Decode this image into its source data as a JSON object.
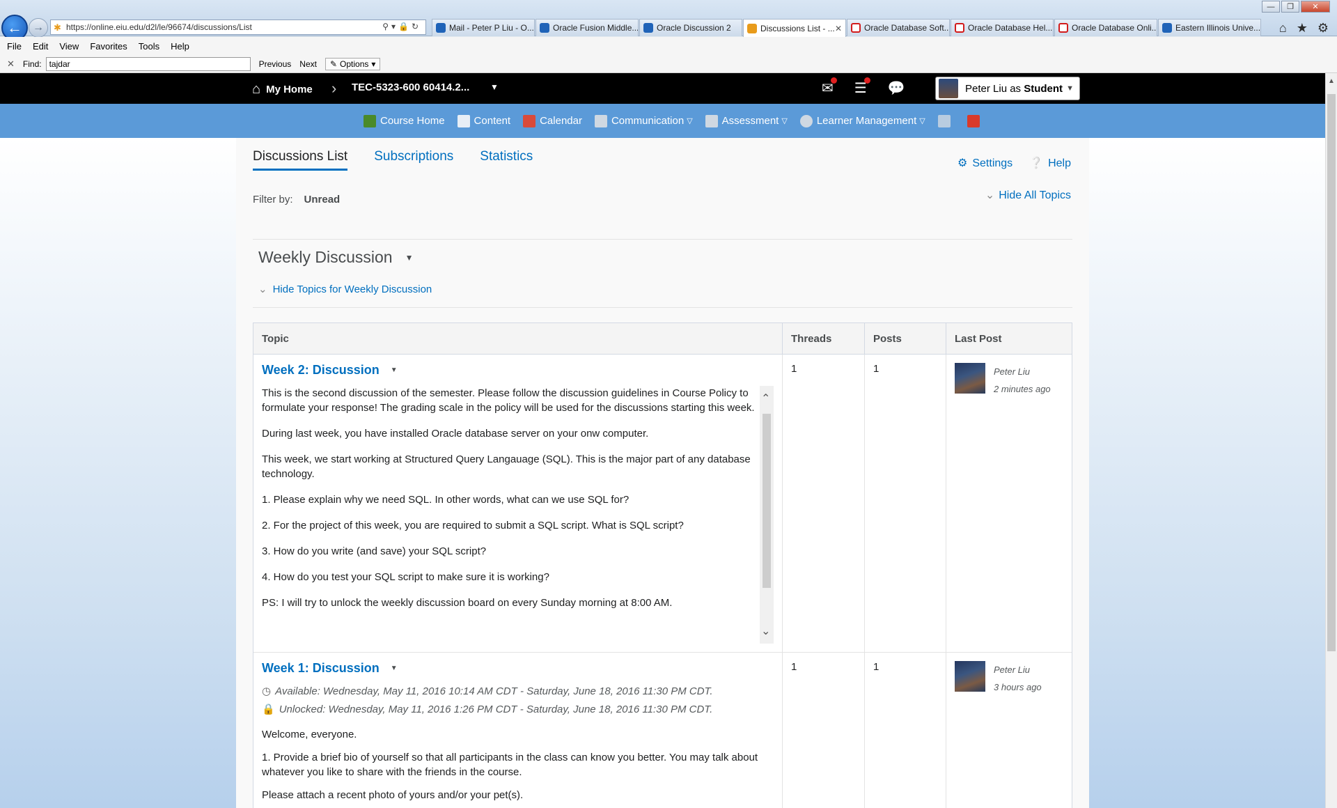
{
  "browser": {
    "url": "https://online.eiu.edu/d2l/le/96674/discussions/List",
    "tabs": [
      {
        "label": "Mail - Peter P Liu - O...",
        "icon": "outlook-icon"
      },
      {
        "label": "Oracle Fusion Middle...",
        "icon": "page-icon"
      },
      {
        "label": "Oracle Discussion 2",
        "icon": "page-icon"
      },
      {
        "label": "Discussions List - ...",
        "icon": "d2l-icon",
        "active": true
      },
      {
        "label": "Oracle Database Soft...",
        "icon": "oracle-icon"
      },
      {
        "label": "Oracle Database Hel...",
        "icon": "oracle-icon"
      },
      {
        "label": "Oracle Database Onli...",
        "icon": "oracle-icon"
      },
      {
        "label": "Eastern Illinois Unive...",
        "icon": "page-icon"
      }
    ],
    "menu": [
      "File",
      "Edit",
      "View",
      "Favorites",
      "Tools",
      "Help"
    ],
    "find": {
      "label": "Find:",
      "value": "tajdar",
      "previous": "Previous",
      "next": "Next",
      "options": "Options"
    }
  },
  "header": {
    "my_home": "My Home",
    "course": "TEC-5323-600 60414.2...",
    "user_name": "Peter Liu as ",
    "user_role": "Student"
  },
  "nav": {
    "items": [
      "Course Home",
      "Content",
      "Calendar",
      "Communication",
      "Assessment",
      "Learner Management"
    ]
  },
  "subtabs": [
    "Discussions List",
    "Subscriptions",
    "Statistics"
  ],
  "settings_label": "Settings",
  "help_label": "Help",
  "filter": {
    "label": "Filter by:",
    "value": "Unread"
  },
  "hide_all_topics": "Hide All Topics",
  "forum": {
    "title": "Weekly Discussion",
    "hide_topics": "Hide Topics for Weekly Discussion"
  },
  "table": {
    "headers": [
      "Topic",
      "Threads",
      "Posts",
      "Last Post"
    ],
    "rows": [
      {
        "title": "Week 2: Discussion",
        "threads": "1",
        "posts": "1",
        "last_author": "Peter Liu",
        "last_time": "2 minutes ago",
        "paragraphs": [
          "This is the second discussion of the semester. Please follow the discussion guidelines in Course Policy to formulate your response! The grading scale in the policy will be used for the discussions starting this week.",
          "During last week, you have installed Oracle database server on your onw computer.",
          "This week, we start working at Structured Query Langauage (SQL). This is the major part of any database technology.",
          "1. Please explain why we need SQL. In other words, what can we use SQL for?",
          "2. For the project of this week, you are required to submit a SQL script.   What is SQL script?",
          "3. How do you write (and save) your SQL script?",
          "4. How do you test your SQL script to make sure it is working?",
          "PS: I will try to unlock the weekly discussion board on every Sunday morning at 8:00 AM."
        ]
      },
      {
        "title": "Week 1: Discussion",
        "threads": "1",
        "posts": "1",
        "last_author": "Peter Liu",
        "last_time": "3 hours ago",
        "available": "Available: Wednesday, May 11, 2016 10:14 AM CDT - Saturday, June 18, 2016 11:30 PM CDT.",
        "unlocked": "Unlocked: Wednesday, May 11, 2016 1:26 PM CDT - Saturday, June 18, 2016 11:30 PM CDT.",
        "paragraphs": [
          "Welcome, everyone.",
          "1. Provide a brief bio of yourself so that all participants in the class can know you better. You may talk about whatever you like to share with the friends in the course.",
          "Please attach a recent photo of yours and/or your pet(s)."
        ]
      }
    ]
  },
  "colors": {
    "link": "#006fbf",
    "nav_bar": "#5b9ad8",
    "top_bar": "#000000"
  }
}
